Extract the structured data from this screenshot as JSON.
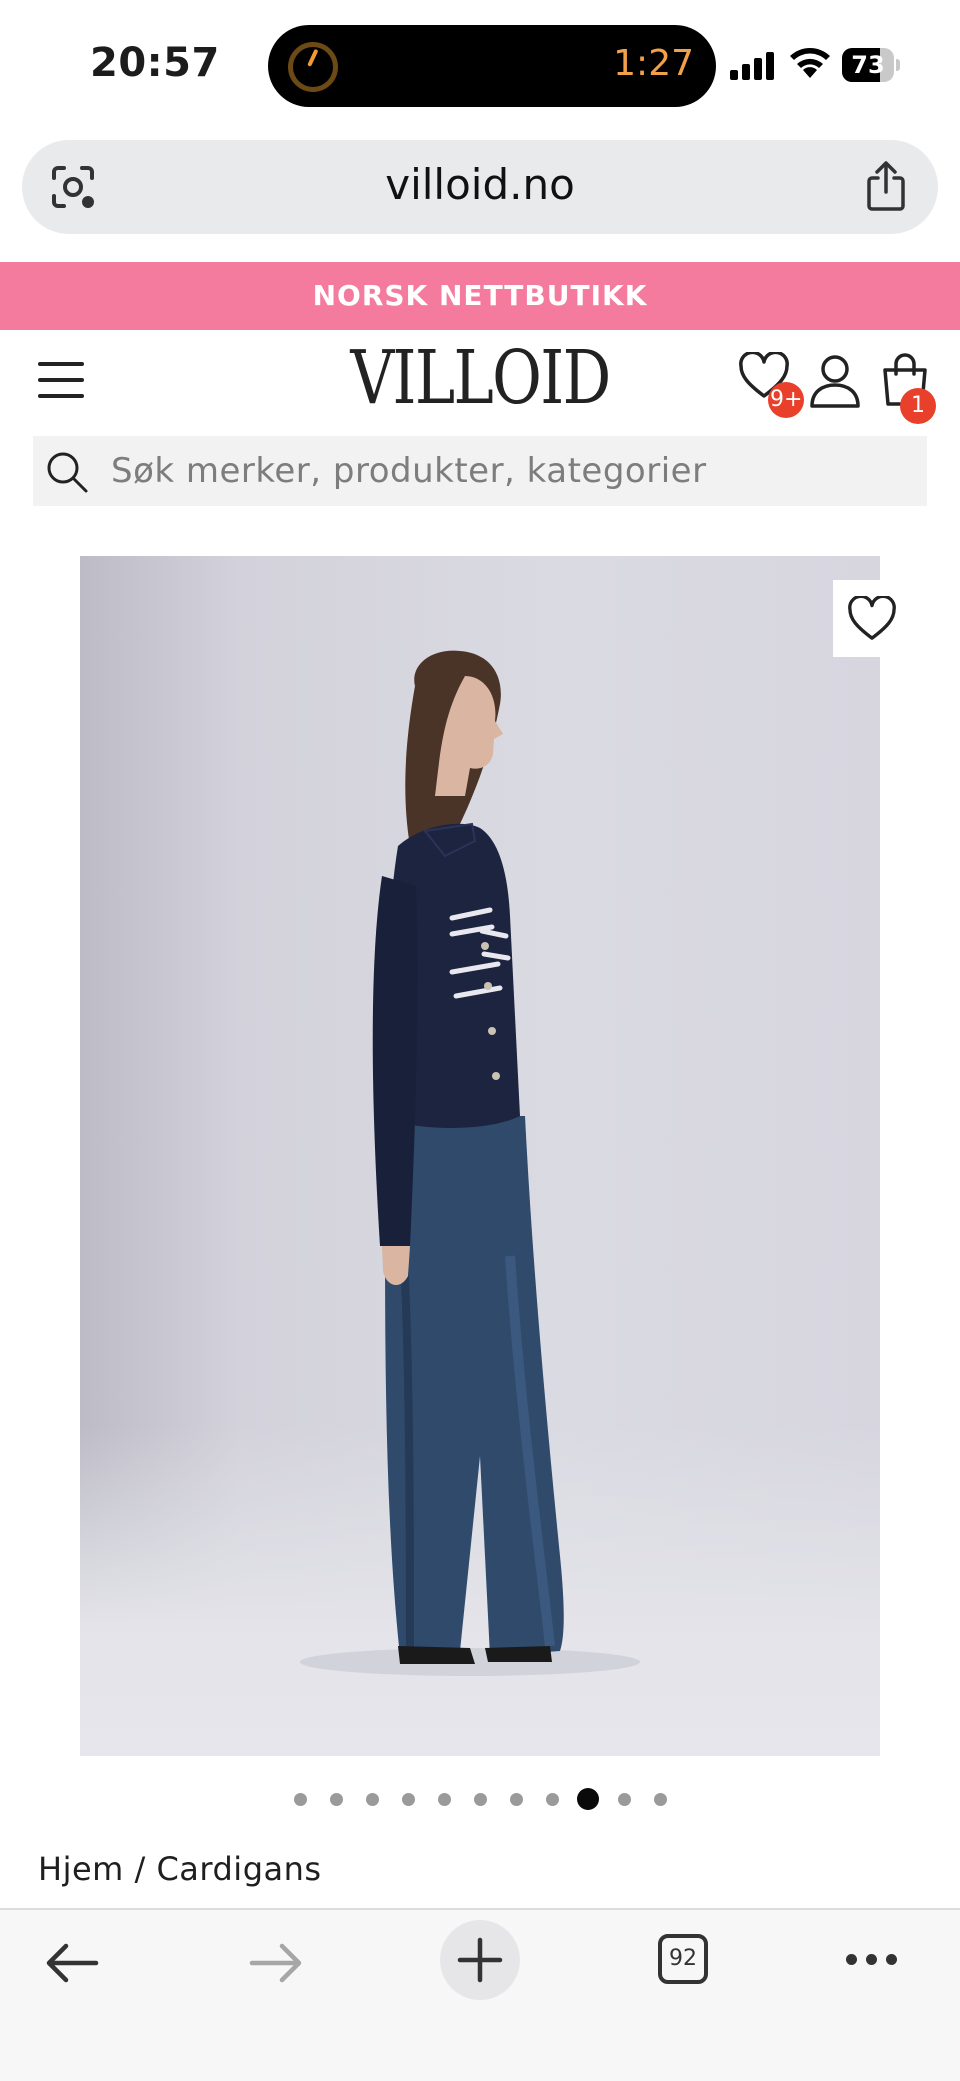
{
  "status_bar": {
    "time": "20:57",
    "activity_timer": "1:27",
    "battery_percent": "73",
    "battery_level": 0.73
  },
  "browser": {
    "url": "villoid.no",
    "open_tabs": "92"
  },
  "promo_banner": {
    "text": "NORSK NETTBUTIKK",
    "color": "#f47b9e"
  },
  "header": {
    "logo": "VILLOID",
    "wishlist_badge": "9+",
    "cart_badge": "1",
    "badge_color": "#e8402a"
  },
  "search": {
    "placeholder": "Søk merker, produkter, kategorier"
  },
  "product": {
    "image_alt": "Model wearing navy cardigan with white stripes and wide-leg jeans",
    "carousel": {
      "total_slides": 11,
      "active_index": 8
    }
  },
  "breadcrumb": "Hjem / Cardigans"
}
